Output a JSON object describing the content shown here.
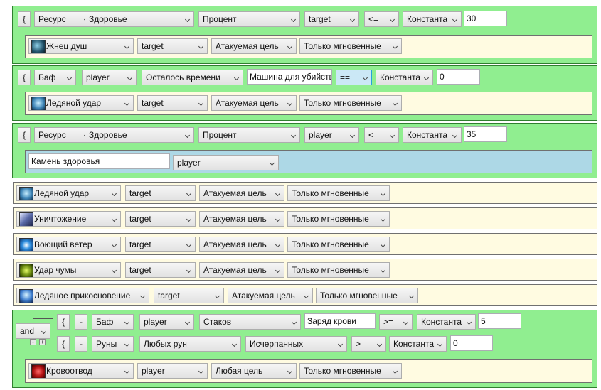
{
  "rows": [
    {
      "open": "{",
      "c1": "Ресурс",
      "c2": "Здоровье",
      "c3": "Процент",
      "c4": "target",
      "op": "<=",
      "c5": "Константа",
      "val": "30",
      "action": {
        "icon": "soul-reaper-icon",
        "spell": "Жнец душ",
        "target": "target",
        "mode": "Атакуемая цель",
        "cast": "Только мгновенные"
      }
    },
    {
      "open": "{",
      "c1": "Баф",
      "c2": "player",
      "c3": "Осталось времени",
      "c4": "Машина для убийств",
      "op": "==",
      "c5": "Константа",
      "val": "0",
      "action": {
        "icon": "frost-strike-icon",
        "spell": "Ледяной удар",
        "target": "target",
        "mode": "Атакуемая цель",
        "cast": "Только мгновенные"
      }
    },
    {
      "open": "{",
      "c1": "Ресурс",
      "c2": "Здоровье",
      "c3": "Процент",
      "c4": "player",
      "op": "<=",
      "c5": "Константа",
      "val": "35",
      "action": {
        "item": "Камень здоровья",
        "target": "player"
      }
    }
  ],
  "spells": [
    {
      "icon": "frost-strike-icon",
      "spell": "Ледяной удар",
      "target": "target",
      "mode": "Атакуемая цель",
      "cast": "Только мгновенные"
    },
    {
      "icon": "obliterate-icon",
      "spell": "Уничтожение",
      "target": "target",
      "mode": "Атакуемая цель",
      "cast": "Только мгновенные"
    },
    {
      "icon": "howling-blast-icon",
      "spell": "Воющий ветер",
      "target": "target",
      "mode": "Атакуемая цель",
      "cast": "Только мгновенные"
    },
    {
      "icon": "plague-strike-icon",
      "spell": "Удар чумы",
      "target": "target",
      "mode": "Атакуемая цель",
      "cast": "Только мгновенные"
    },
    {
      "icon": "icy-touch-icon",
      "spell": "Ледяное прикосновение",
      "target": "target",
      "mode": "Атакуемая цель",
      "cast": "Только мгновенные"
    }
  ],
  "group": {
    "logic": "and",
    "mini_minus": "-",
    "mini_plus": "+",
    "lines": [
      {
        "open": "{",
        "minus": "-",
        "c1": "Баф",
        "c2": "player",
        "c3": "Стаков",
        "c4": "Заряд крови",
        "op": ">=",
        "c5": "Константа",
        "val": "5"
      },
      {
        "open": "{",
        "minus": "-",
        "c1": "Руны",
        "c2": "Любых рун",
        "c3": "Исчерпанных",
        "op": ">",
        "c5": "Константа",
        "val": "0"
      }
    ],
    "action": {
      "icon": "blood-tap-icon",
      "spell": "Кровоотвод",
      "target": "player",
      "mode": "Любая цель",
      "cast": "Только мгновенные"
    }
  }
}
